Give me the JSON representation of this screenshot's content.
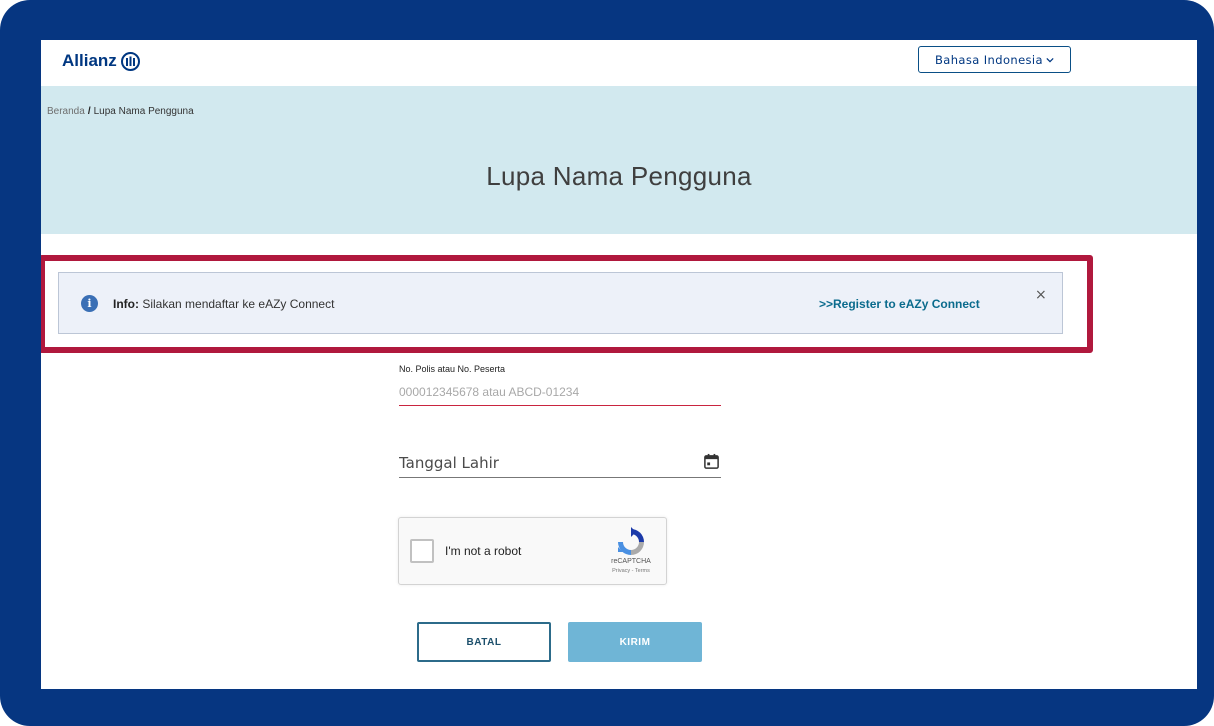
{
  "header": {
    "brand": "Allianz",
    "language_label": "Bahasa Indonesia"
  },
  "breadcrumb": {
    "home": "Beranda",
    "separator": "/",
    "current": "Lupa Nama Pengguna"
  },
  "page": {
    "title": "Lupa Nama Pengguna"
  },
  "info_banner": {
    "prefix": "Info:",
    "message": "Silakan mendaftar ke eAZy Connect",
    "link": ">>Register to eAZy Connect",
    "close": "×"
  },
  "form": {
    "policy_label": "No. Polis atau No. Peserta",
    "policy_placeholder": "000012345678 atau ABCD-01234",
    "dob_placeholder": "Tanggal Lahir",
    "captcha_label": "I'm not a robot",
    "captcha_brand": "reCAPTCHA",
    "captcha_links": "Privacy - Terms",
    "cancel_label": "BATAL",
    "submit_label": "KIRIM"
  },
  "colors": {
    "frame": "#063681",
    "hero_bg": "#d2e9ef",
    "highlight": "#b0183d",
    "brand": "#003781",
    "submit": "#6fb5d6"
  }
}
